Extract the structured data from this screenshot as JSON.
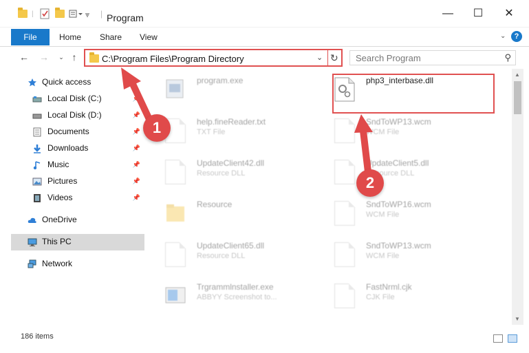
{
  "window": {
    "title": "Program",
    "minimize": "—",
    "maximize": "☐",
    "close": "✕"
  },
  "ribbon": {
    "tabs": [
      "File",
      "Home",
      "Share",
      "View"
    ]
  },
  "address": {
    "path": "C:\\Program Files\\Program Directory",
    "search_placeholder": "Search Program"
  },
  "navpane": {
    "quick_access": "Quick access",
    "items": [
      {
        "label": "Local Disk (C:)",
        "pinned": true
      },
      {
        "label": "Local Disk (D:)",
        "pinned": true
      },
      {
        "label": "Documents",
        "pinned": true
      },
      {
        "label": "Downloads",
        "pinned": true
      },
      {
        "label": "Music",
        "pinned": true
      },
      {
        "label": "Pictures",
        "pinned": true
      },
      {
        "label": "Videos",
        "pinned": true
      }
    ],
    "onedrive": "OneDrive",
    "thispc": "This PC",
    "network": "Network"
  },
  "files": {
    "left": [
      {
        "name": "program.exe",
        "type": ""
      },
      {
        "name": "help.fineReader.txt",
        "type": "TXT File"
      },
      {
        "name": "UpdateClient42.dll",
        "type": "Resource DLL"
      },
      {
        "name": "Resource",
        "type": ""
      },
      {
        "name": "UpdateClient65.dll",
        "type": "Resource DLL"
      },
      {
        "name": "Trgrammlnstaller.exe",
        "type": "ABBYY Screenshot to..."
      }
    ],
    "right": [
      {
        "name": "php3_interbase.dll",
        "type": ""
      },
      {
        "name": "SndToWP13.wcm",
        "type": "WCM File"
      },
      {
        "name": "UpdateClient5.dll",
        "type": "Resource DLL"
      },
      {
        "name": "SndToWP16.wcm",
        "type": "WCM File"
      },
      {
        "name": "SndToWP13.wcm",
        "type": "WCM File"
      },
      {
        "name": "FastNrml.cjk",
        "type": "CJK File"
      }
    ]
  },
  "status": {
    "count": "186 items"
  },
  "annotations": {
    "step1": "1",
    "step2": "2",
    "color": "#e04a4a"
  }
}
